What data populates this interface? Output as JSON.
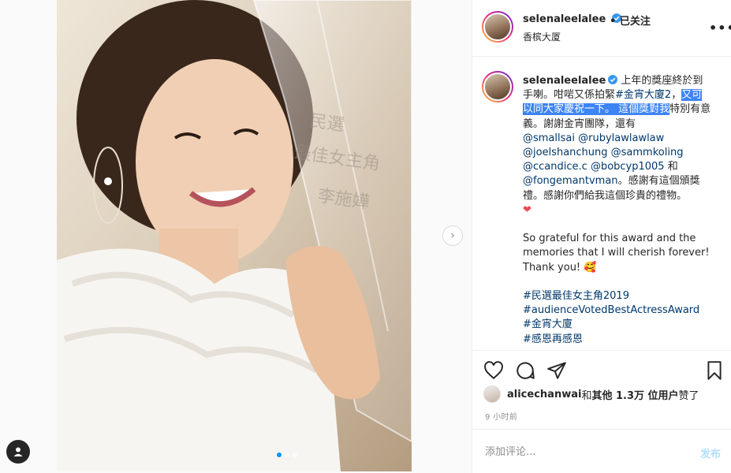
{
  "post": {
    "username": "selenaleelalee",
    "follow_status": "• 已关注",
    "location": "香槟大厦",
    "more_label": "•••"
  },
  "caption": {
    "username": "selenaleelalee",
    "t1": " 上年的獎座終於到手喇。咁啱又係拍緊",
    "tag_drama": "#金宵大廈2",
    "t2": "，",
    "hl1": "又可以同大家慶祝一下。 這個獎對我",
    "t3": "特別有意義。謝謝金宵團隊，還有",
    "m1": "@smallsai",
    "m2": "@rubylawlawlaw",
    "m3": "@joelshanchung",
    "m4": "@sammkoling",
    "m5": "@ccandice.c",
    "m6": "@bobcyp1005",
    "and": " 和 ",
    "m7": "@fongemantvman",
    "t4": "。感謝有這個頒獎禮。感謝你們給我這個珍貴的禮物。",
    "heart": "❤",
    "english": "So grateful for this award and the memories that I will cherish forever! Thank you! ",
    "emoji": "🥰",
    "h1": "#民選最佳女主角2019",
    "h2": "#audienceVotedBestActressAward",
    "h3": "#金宵大廈",
    "h4": "#感恩再感恩"
  },
  "likes": {
    "user": "alicechanwai",
    "mid": " 和 ",
    "others": "其他 1.3万 位用户",
    "end": " 赞了"
  },
  "time_ago": "9 小时前",
  "comment_box": {
    "placeholder": "添加评论...",
    "post_label": "发布"
  },
  "photo": {
    "trophy_text": [
      "民選",
      "最佳女主角",
      "李施嬅"
    ]
  },
  "colors": {
    "link": "#00376b",
    "highlight": "#3d84f5",
    "verified": "#3897f0",
    "heart": "#ed4956"
  }
}
